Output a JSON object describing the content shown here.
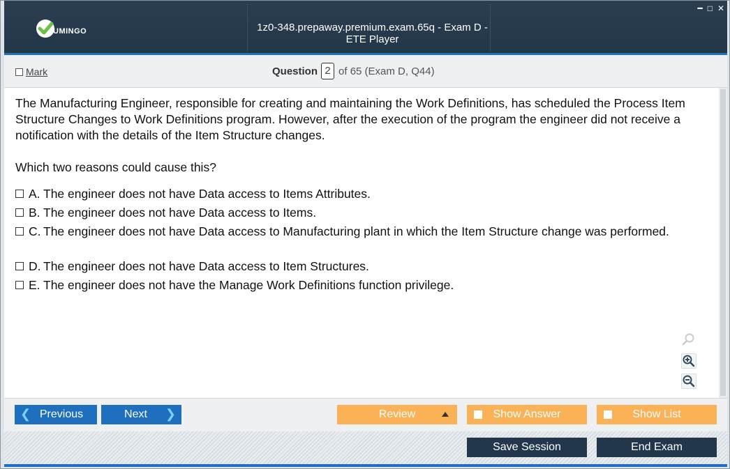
{
  "window": {
    "brand": "UMINGO",
    "title": "1z0-348.prepaway.premium.exam.65q - Exam D - ETE Player",
    "controls": [
      "minimize",
      "maximize",
      "close"
    ]
  },
  "question_bar": {
    "mark_label": "Mark",
    "question_label": "Question",
    "question_number": "2",
    "question_rest": "of 65 (Exam D, Q44)"
  },
  "question": {
    "text": "The Manufacturing Engineer, responsible for creating and maintaining the Work Definitions, has scheduled the Process Item Structure Changes to Work Definitions program. However, after the execution of the program the engineer did not receive a notification with the details of the Item Structure changes.",
    "prompt": "Which two reasons could cause this?",
    "options": [
      {
        "letter": "A.",
        "text": "The engineer does not have Data access to Items Attributes."
      },
      {
        "letter": "B.",
        "text": "The engineer does not have Data access to Items."
      },
      {
        "letter": "C.",
        "text": "The engineer does not have Data access to Manufacturing plant in which the Item Structure change was performed."
      },
      {
        "letter": "D.",
        "text": "The engineer does not have Data access to Item Structures."
      },
      {
        "letter": "E.",
        "text": "The engineer does not have the Manage Work Definitions function privilege."
      }
    ]
  },
  "nav": {
    "previous": "Previous",
    "next": "Next",
    "review": "Review",
    "show_answer": "Show Answer",
    "show_list": "Show List",
    "save_session": "Save Session",
    "end_exam": "End Exam"
  },
  "colors": {
    "titlebar": "#263a4d",
    "accent_blue": "#1f6fbf",
    "orange": "#fbb155",
    "dark_button": "#22374c",
    "logo_green": "#6cc04a"
  }
}
